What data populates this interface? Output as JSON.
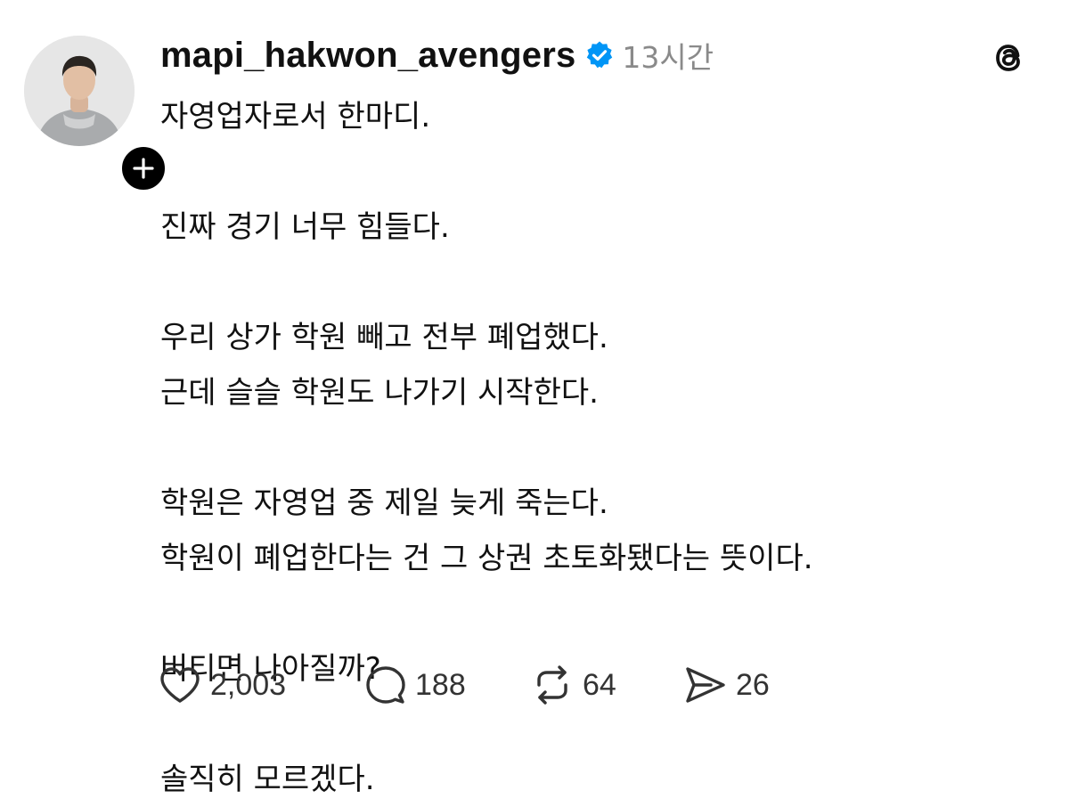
{
  "post": {
    "username": "mapi_hakwon_avengers",
    "timestamp": "13시간",
    "lines": [
      "자영업자로서 한마디.",
      "",
      "진짜 경기 너무 힘들다.",
      "",
      "우리 상가 학원 빼고 전부 폐업했다.",
      "근데 슬슬 학원도 나가기 시작한다.",
      "",
      "학원은 자영업 중 제일 늦게 죽는다.",
      "학원이 폐업한다는 건 그 상권 초토화됐다는 뜻이다.",
      "",
      "버티면 나아질까?",
      "",
      "솔직히 모르겠다."
    ]
  },
  "actions": {
    "likes": "2,003",
    "replies": "188",
    "reposts": "64",
    "shares": "26"
  },
  "icons": {
    "verified": "verified-badge-icon",
    "follow": "plus-icon",
    "app": "threads-logo-icon",
    "like": "heart-icon",
    "reply": "speech-bubble-icon",
    "repost": "repost-icon",
    "share": "send-icon"
  },
  "colors": {
    "verified_blue": "#0095f6",
    "text": "#111111",
    "muted": "#8a8a8a"
  }
}
